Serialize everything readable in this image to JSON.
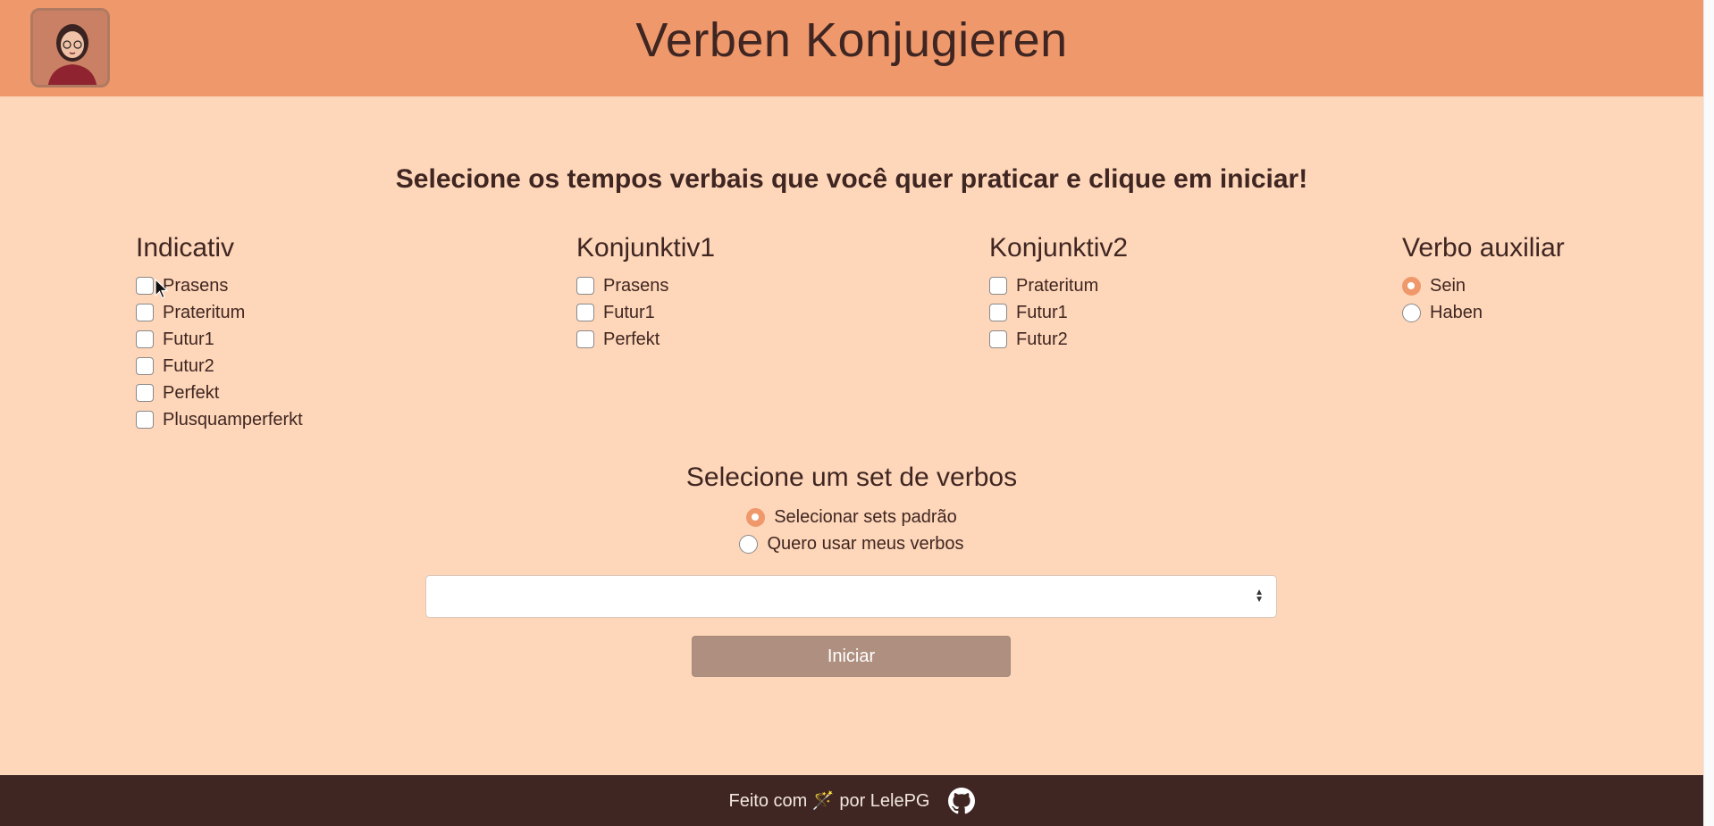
{
  "header": {
    "title": "Verben Konjugieren",
    "avatar_icon": "avatar-icon"
  },
  "instruction": "Selecione os tempos verbais que você quer praticar e clique em iniciar!",
  "groups": {
    "indicativ": {
      "title": "Indicativ",
      "options": [
        "Prasens",
        "Prateritum",
        "Futur1",
        "Futur2",
        "Perfekt",
        "Plusquamperferkt"
      ]
    },
    "konjunktiv1": {
      "title": "Konjunktiv1",
      "options": [
        "Prasens",
        "Futur1",
        "Perfekt"
      ]
    },
    "konjunktiv2": {
      "title": "Konjunktiv2",
      "options": [
        "Prateritum",
        "Futur1",
        "Futur2"
      ]
    },
    "auxiliar": {
      "title": "Verbo auxiliar",
      "options": [
        "Sein",
        "Haben"
      ],
      "selected": "Sein"
    }
  },
  "verb_set": {
    "title": "Selecione um set de verbos",
    "options": [
      "Selecionar sets padrão",
      "Quero usar meus verbos"
    ],
    "selected": "Selecionar sets padrão",
    "select_value": ""
  },
  "start_button": "Iniciar",
  "footer": {
    "text": "Feito com 🪄 por LelePG",
    "icon": "github-icon"
  },
  "colors": {
    "header_bg": "#ef986b",
    "page_bg": "#fed6b9",
    "footer_bg": "#3f2622",
    "button_bg": "#af9080",
    "accent": "#ef986b"
  }
}
